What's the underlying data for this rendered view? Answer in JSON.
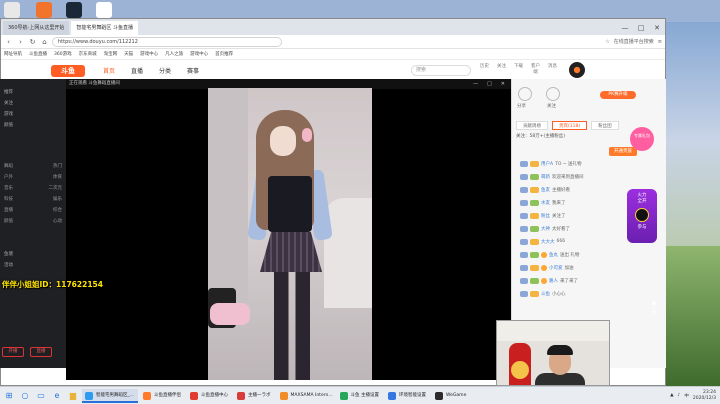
{
  "browser": {
    "tabs": [
      {
        "label": "360导航-上网从这里开始"
      },
      {
        "label": "智能宅男舞蹈区 斗鱼直播"
      }
    ],
    "url": "https://www.douyu.com/112212",
    "window_controls": [
      "—",
      "□",
      "✕"
    ],
    "addr_right": "在线直播平台搜索",
    "bookmarks": [
      "网址导航",
      "斗鱼直播",
      "360游戏",
      "京东商城",
      "淘宝网",
      "天猫",
      "游戏中心",
      "凡人之旅",
      "游戏中心",
      "首页推荐"
    ]
  },
  "site": {
    "logo": "斗鱼",
    "nav": [
      "首页",
      "直播",
      "分类",
      "赛事"
    ],
    "search_placeholder": "搜索",
    "header_icons": [
      "历史",
      "关注",
      "下载",
      "客户端",
      "消息"
    ]
  },
  "sidebar": {
    "items": [
      "推荐",
      "关注",
      "游戏",
      "颜值"
    ],
    "rows": [
      [
        "舞蹈",
        "热门"
      ],
      [
        "户外",
        "体育"
      ],
      [
        "音乐",
        "二次元"
      ],
      [
        "科技",
        "娱乐"
      ],
      [
        "直播",
        "综合"
      ],
      [
        "颜值",
        "心动"
      ]
    ],
    "lower_items": [
      "鱼塘",
      "活动"
    ],
    "buttons": [
      "开播",
      "直播"
    ]
  },
  "player": {
    "title": "正在观看 斗鱼舞蹈直播间",
    "controls": [
      "—",
      "□",
      "✕"
    ],
    "overlay_id": "伴伴小姐姐ID：117622154"
  },
  "right_panel": {
    "icons": [
      "分享",
      "关注"
    ],
    "badge": "PK赛升级",
    "tabs": [
      "贡献周榜",
      "贵宾(118)",
      "粉丝团"
    ],
    "info": "关注：58万+(主播粉丝)",
    "button": "开通贵族",
    "promo_top": "专属礼包",
    "promo_side": [
      "火力",
      "全开",
      "参与"
    ],
    "messages": [
      {
        "nick": "用户A",
        "text": "TO ~ 送礼物"
      },
      {
        "nick": "萌新",
        "text": "欢迎来到直播间"
      },
      {
        "nick": "鱼友",
        "text": "主播好看"
      },
      {
        "nick": "水友",
        "text": "我来了"
      },
      {
        "nick": "粉丝",
        "text": "关注了"
      },
      {
        "nick": "大神",
        "text": "太好看了"
      },
      {
        "nick": "大大大",
        "text": "666"
      },
      {
        "nick": "鱼丸",
        "text": "送出 礼物"
      },
      {
        "nick": "小可爱",
        "text": "加油"
      },
      {
        "nick": "路人",
        "text": "来了来了"
      },
      {
        "nick": "斗鱼",
        "text": "小心心"
      }
    ]
  },
  "taskbar": {
    "apps": [
      {
        "label": "智能宅男舞蹈区_...",
        "color": "#2c9bf0",
        "active": true
      },
      {
        "label": "斗鱼直播伴侣",
        "color": "#ff7a2a",
        "active": false
      },
      {
        "label": "斗鱼直播中心",
        "color": "#e03c2f",
        "active": false
      },
      {
        "label": "主播一ラボ",
        "color": "#d93b3b",
        "active": false
      },
      {
        "label": "MAXSAMA Intern...",
        "color": "#f28c28",
        "active": false
      },
      {
        "label": "斗鱼 主播设置",
        "color": "#26a65b",
        "active": false
      },
      {
        "label": "环境智能设置",
        "color": "#3577e0",
        "active": false
      },
      {
        "label": "WeGame",
        "color": "#2b2b2b",
        "active": false
      }
    ],
    "tray_lang": "中",
    "time": "23:24",
    "date": "2020/12/3"
  }
}
